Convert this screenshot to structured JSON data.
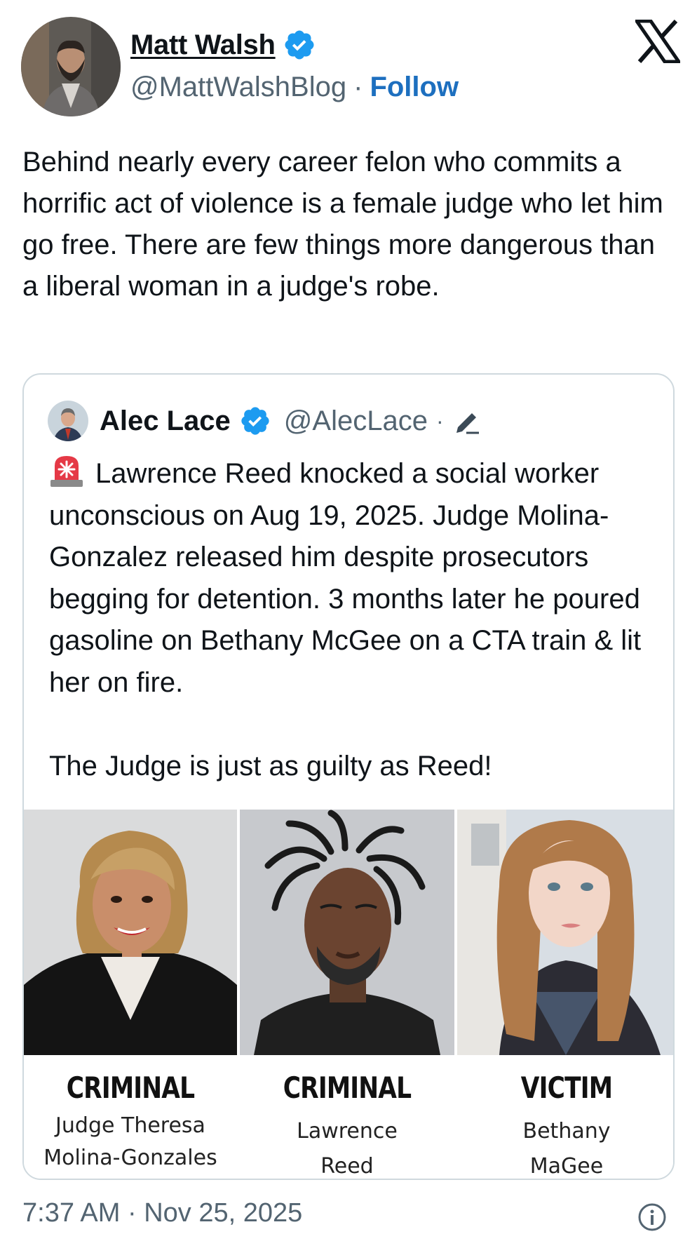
{
  "author": {
    "name": "Matt Walsh",
    "handle": "@MattWalshBlog",
    "separator": "·",
    "follow_label": "Follow",
    "verified_color": "#1d9bf0",
    "avatar_icon": "author-avatar"
  },
  "brand_icon": "x-logo-icon",
  "tweet": {
    "text": "Behind nearly every career felon who commits a horrific act of violence is a female judge who let him go free. There are few things more dangerous than a liberal woman in a judge's robe."
  },
  "quoted": {
    "name": "Alec Lace",
    "handle": "@AlecLace",
    "separator": "·",
    "edit_icon": "edit-pencil-icon",
    "siren_icon": "police-siren-emoji",
    "text": "Lawrence Reed knocked a social worker unconscious on Aug 19, 2025. Judge Molina-Gonzalez released him despite prosecutors begging for detention. 3 months later he poured gasoline on Bethany McGee on a CTA train & lit her on fire.\n\nThe Judge is just as guilty as Reed!",
    "image": {
      "panels": [
        {
          "title": "CRIMINAL",
          "line1": "Judge Theresa",
          "line2": "Molina-Gonzales"
        },
        {
          "title": "CRIMINAL",
          "line1": "Lawrence",
          "line2": "Reed"
        },
        {
          "title": "VICTIM",
          "line1": "Bethany",
          "line2": "MaGee"
        }
      ]
    }
  },
  "footer": {
    "timestamp": "7:37 AM · Nov 25, 2025",
    "info_icon": "info-icon"
  }
}
